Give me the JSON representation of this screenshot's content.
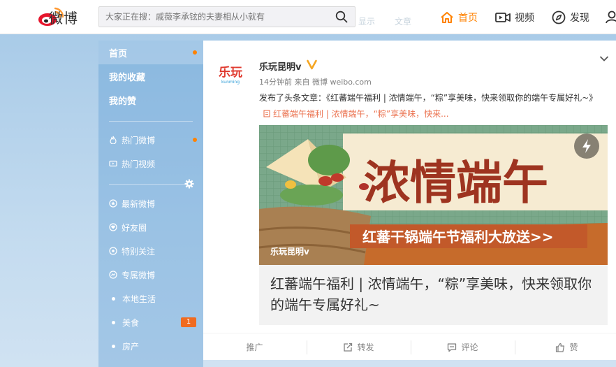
{
  "header": {
    "logo_text": "微博",
    "search_placeholder": "大家正在搜：戚薇李承铉的夫妻相从小就有",
    "ghost_links": [
      "显示",
      "文章"
    ],
    "nav": [
      {
        "label": "首页",
        "icon": "home-icon",
        "active": true
      },
      {
        "label": "视频",
        "icon": "video-icon",
        "active": false
      },
      {
        "label": "发现",
        "icon": "compass-icon",
        "active": false
      }
    ],
    "accent_color": "#ff8200"
  },
  "sidebar": {
    "items": [
      {
        "label": "首页",
        "style": "big",
        "active": true,
        "dot": true
      },
      {
        "label": "我的收藏",
        "style": "big"
      },
      {
        "label": "我的赞",
        "style": "big"
      },
      {
        "label": "热门微博",
        "icon": "fire-icon",
        "dot": true
      },
      {
        "label": "热门视频",
        "icon": "video-icon"
      },
      {
        "label": "最新微博",
        "icon": "star-circle-icon"
      },
      {
        "label": "好友圈",
        "icon": "heart-circle-icon"
      },
      {
        "label": "特别关注",
        "icon": "eye-circle-icon"
      },
      {
        "label": "专属微博",
        "icon": "exclusive-icon"
      },
      {
        "label": "本地生活",
        "bullet": true
      },
      {
        "label": "美食",
        "bullet": true,
        "badge": "1"
      },
      {
        "label": "房产",
        "bullet": true
      }
    ]
  },
  "post": {
    "author": "乐玩昆明v",
    "meta": "14分钟前 来自 微博 weibo.com",
    "text_prefix": "发布了头条文章：《红蕃端午福利 | 浓情端午，“粽”享美味，快来领取你的端午专属好礼~》",
    "link_text": "红蕃端午福利 | 浓情端午，“粽”享美味，快来...",
    "banner": {
      "title": "浓情端午",
      "subtitle": "红蕃干锅端午节福利大放送>>",
      "watermark": "乐玩昆明v"
    },
    "article_title": "红蕃端午福利 | 浓情端午，“粽”享美味，快来领取你的端午专属好礼~",
    "actions": [
      {
        "label": "推广",
        "icon": ""
      },
      {
        "label": "转发",
        "icon": "repost-icon"
      },
      {
        "label": "评论",
        "icon": "comment-icon"
      },
      {
        "label": "赞",
        "icon": "thumbs-up-icon"
      }
    ]
  }
}
